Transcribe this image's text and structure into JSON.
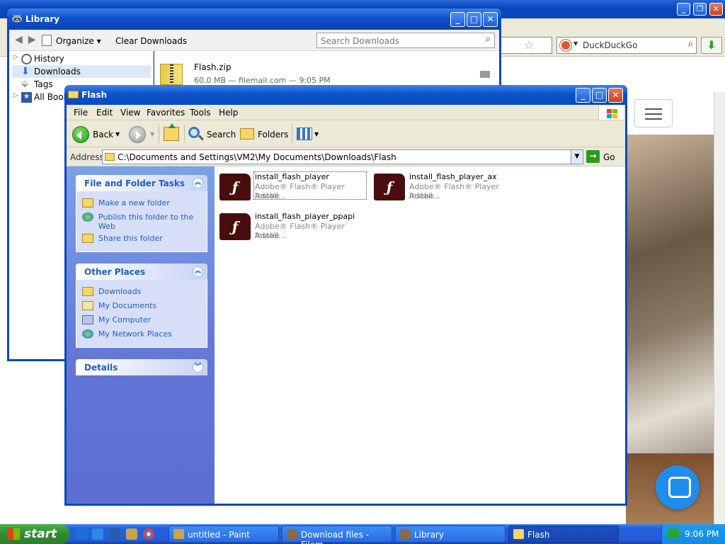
{
  "browser": {
    "search_placeholder": "DuckDuckGo",
    "title_buttons": [
      "_",
      "❐",
      "✕"
    ]
  },
  "library": {
    "title": "Library",
    "organize_label": "Organize",
    "clear_label": "Clear Downloads",
    "search_placeholder": "Search Downloads",
    "sidebar": [
      {
        "label": "History",
        "icon": "clock-icon"
      },
      {
        "label": "Downloads",
        "icon": "download-arrow-icon"
      },
      {
        "label": "Tags",
        "icon": "tag-icon"
      },
      {
        "label": "All Bookmarks",
        "icon": "star-icon"
      }
    ],
    "download": {
      "name": "Flash.zip",
      "info": "60.0 MB — filemail.com — 9:05 PM"
    }
  },
  "explorer": {
    "title": "Flash",
    "menu": [
      "File",
      "Edit",
      "View",
      "Favorites",
      "Tools",
      "Help"
    ],
    "toolbar": {
      "back": "Back",
      "search": "Search",
      "folders": "Folders"
    },
    "address_label": "Address",
    "address_value": "C:\\Documents and Settings\\VM2\\My Documents\\Downloads\\Flash",
    "go_label": "Go",
    "tasks_panel": {
      "title": "File and Folder Tasks",
      "items": [
        "Make a new folder",
        "Publish this folder to the Web",
        "Share this folder"
      ]
    },
    "places_panel": {
      "title": "Other Places",
      "items": [
        "Downloads",
        "My Documents",
        "My Computer",
        "My Network Places"
      ]
    },
    "details_panel": {
      "title": "Details"
    },
    "files": [
      {
        "name": "install_flash_player",
        "desc": "Adobe® Flash® Player Install...",
        "company": "Adobe"
      },
      {
        "name": "install_flash_player_ax",
        "desc": "Adobe® Flash® Player Install...",
        "company": "Adobe"
      },
      {
        "name": "install_flash_player_ppapi",
        "desc": "Adobe® Flash® Player Install...",
        "company": "Adobe"
      }
    ]
  },
  "taskbar": {
    "start_label": "start",
    "tasks": [
      {
        "label": "untitled - Paint"
      },
      {
        "label": "Download files - Filem..."
      },
      {
        "label": "Library"
      },
      {
        "label": "Flash"
      }
    ],
    "clock": "9:06 PM"
  }
}
